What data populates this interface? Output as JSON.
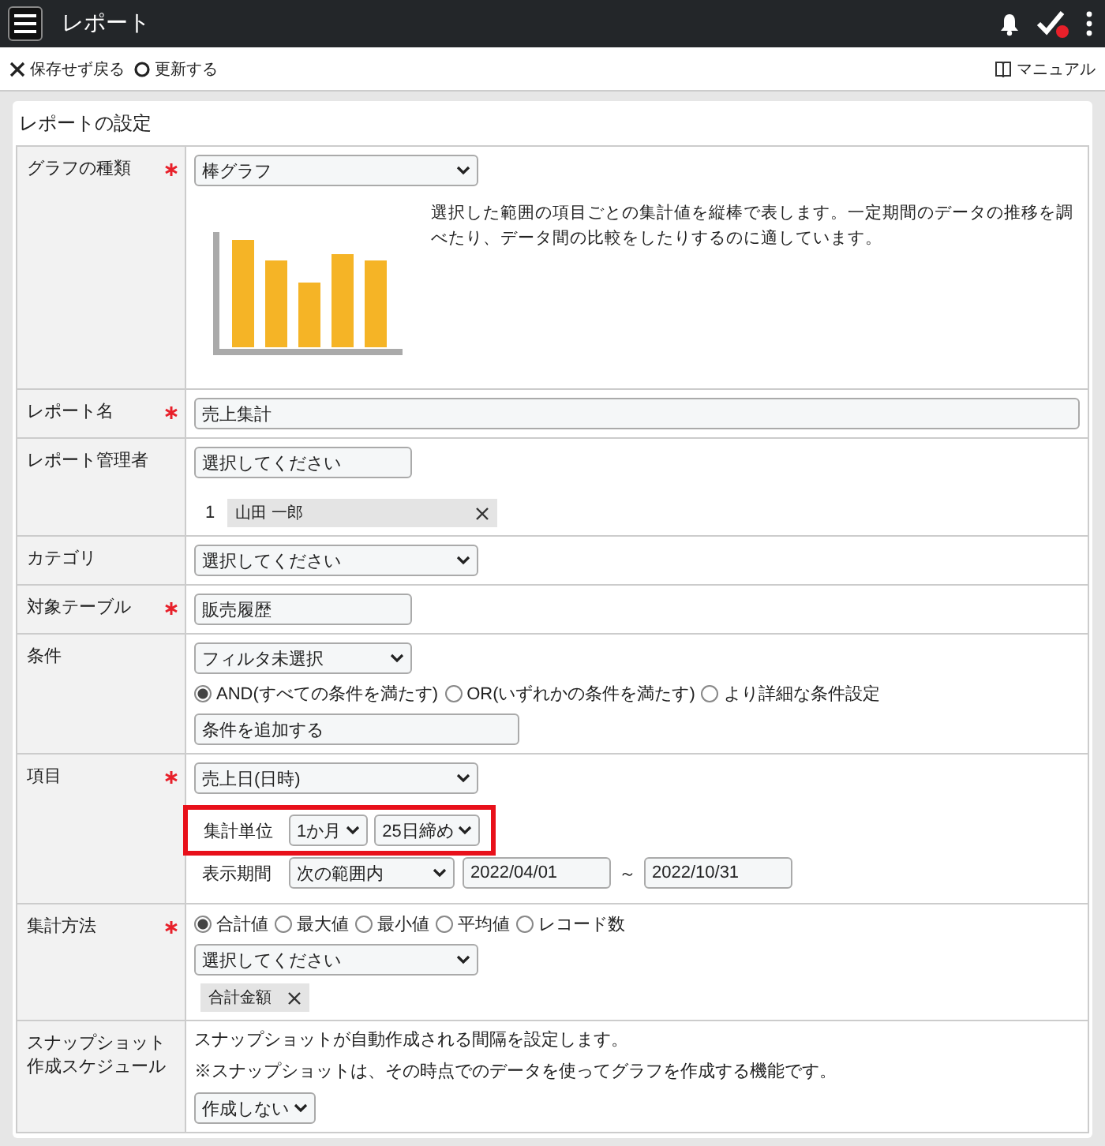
{
  "header": {
    "title": "レポート",
    "check_badge": true
  },
  "toolbar": {
    "actions": [
      {
        "kind": "close",
        "label": "保存せず戻る"
      },
      {
        "kind": "circle",
        "label": "更新する"
      }
    ],
    "manual": "マニュアル"
  },
  "section_title": "レポートの設定",
  "rows": [
    {
      "kind": "graph",
      "label": "グラフの種類",
      "required": true,
      "select": "棒グラフ",
      "description": "選択した範囲の項目ごとの集計値を縦棒で表します。一定期間のデータの推移を調べたり、データ間の比較をしたりするのに適しています。"
    },
    {
      "kind": "text",
      "label": "レポート名",
      "required": true,
      "value": "売上集計"
    },
    {
      "kind": "manager",
      "label": "レポート管理者",
      "required": false,
      "placeholder": "選択してください",
      "members": [
        {
          "index": "1",
          "name": "山田 一郎"
        }
      ]
    },
    {
      "kind": "select",
      "label": "カテゴリ",
      "required": false,
      "select": "選択してください"
    },
    {
      "kind": "readonly",
      "label": "対象テーブル",
      "required": true,
      "value": "販売履歴"
    },
    {
      "kind": "conditions",
      "label": "条件",
      "required": false,
      "select": "フィルタ未選択",
      "options": [
        {
          "label": "AND(すべての条件を満たす)",
          "selected": true
        },
        {
          "label": "OR(いずれかの条件を満たす)",
          "selected": false
        },
        {
          "label": "より詳細な条件設定",
          "selected": false
        }
      ],
      "add_button": "条件を追加する"
    },
    {
      "kind": "items",
      "label": "項目",
      "required": true,
      "select": "売上日(日時)",
      "highlighted": true,
      "unit_label": "集計単位",
      "unit": "1か月",
      "cutoff": "25日締め",
      "period_label": "表示期間",
      "period": "次の範囲内",
      "from": "2022/04/01",
      "separator": "～",
      "to": "2022/10/31"
    },
    {
      "kind": "method",
      "label": "集計方法",
      "required": true,
      "options": [
        {
          "label": "合計値",
          "selected": true
        },
        {
          "label": "最大値",
          "selected": false
        },
        {
          "label": "最小値",
          "selected": false
        },
        {
          "label": "平均値",
          "selected": false
        },
        {
          "label": "レコード数",
          "selected": false
        }
      ],
      "select": "選択してください",
      "tags": [
        "合計金額"
      ]
    },
    {
      "kind": "schedule",
      "label": "スナップショット作成スケジュール",
      "required": false,
      "description": [
        "スナップショットが自動作成される間隔を設定します。",
        "※スナップショットは、その時点でのデータを使ってグラフを作成する機能です。"
      ],
      "select": "作成しない"
    }
  ]
}
